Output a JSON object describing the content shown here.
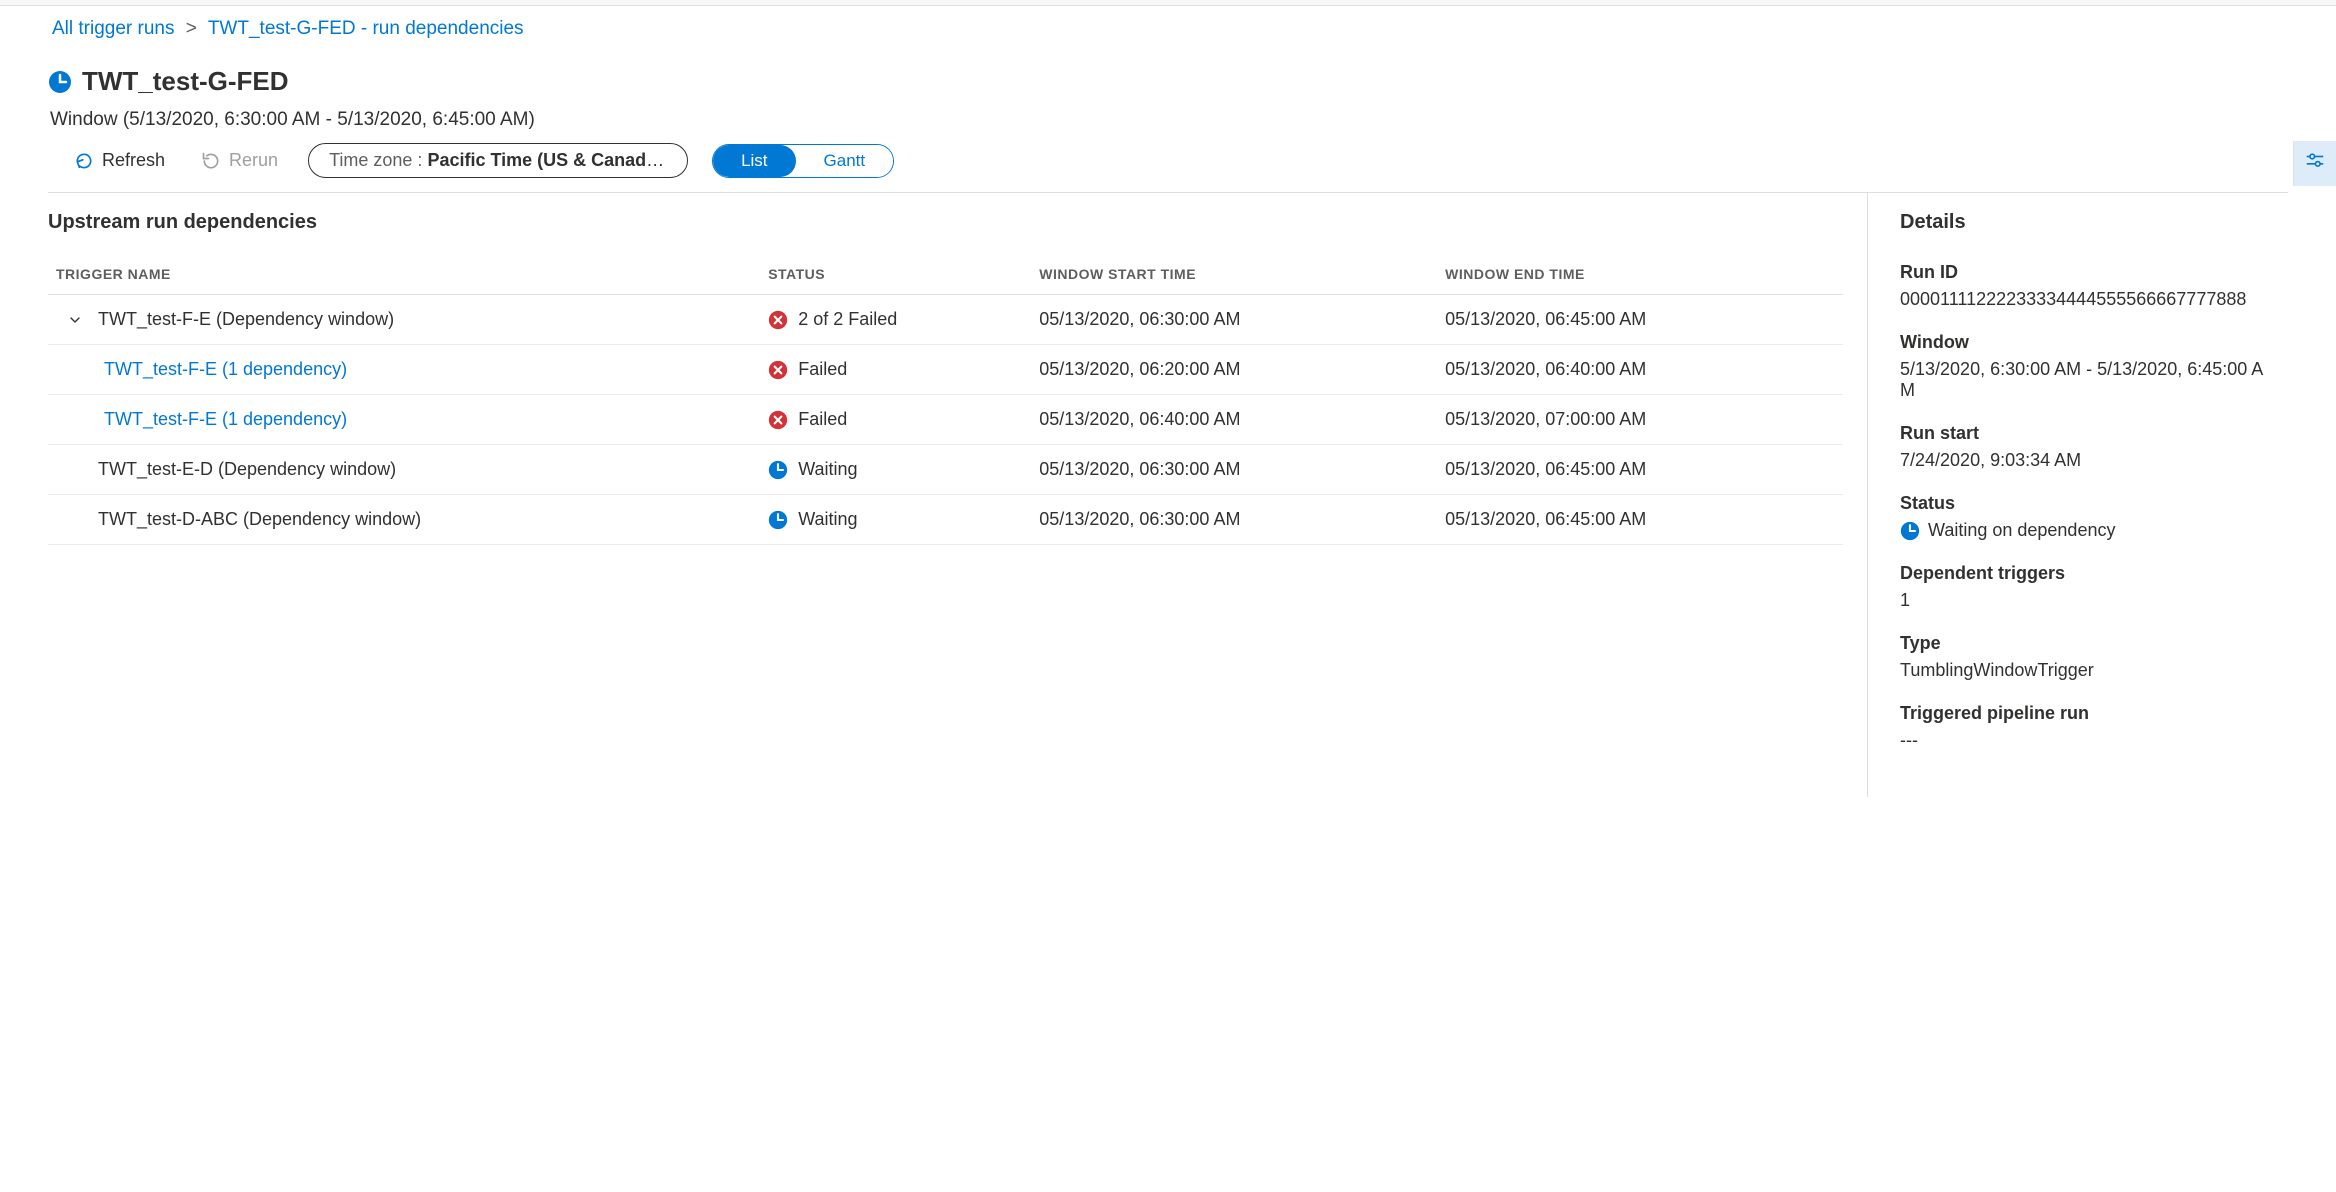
{
  "breadcrumb": {
    "root": "All trigger runs",
    "separator": ">",
    "current": "TWT_test-G-FED - run dependencies"
  },
  "header": {
    "title": "TWT_test-G-FED",
    "window_label": "Window (5/13/2020, 6:30:00 AM - 5/13/2020, 6:45:00 AM)"
  },
  "toolbar": {
    "refresh_label": "Refresh",
    "rerun_label": "Rerun",
    "timezone_prefix": "Time zone : ",
    "timezone_value": "Pacific Time (US & Canada) (UT...",
    "list_label": "List",
    "gantt_label": "Gantt"
  },
  "upstream": {
    "title": "Upstream run dependencies",
    "columns": {
      "trigger_name": "TRIGGER NAME",
      "status": "STATUS",
      "window_start": "WINDOW START TIME",
      "window_end": "WINDOW END TIME"
    },
    "rows": [
      {
        "indent": 0,
        "expandable": true,
        "name": "TWT_test-F-E (Dependency window)",
        "is_link": false,
        "status_kind": "failed",
        "status": "2 of 2 Failed",
        "start": "05/13/2020, 06:30:00 AM",
        "end": "05/13/2020, 06:45:00 AM"
      },
      {
        "indent": 1,
        "expandable": false,
        "name": "TWT_test-F-E (1 dependency)",
        "is_link": true,
        "status_kind": "failed",
        "status": "Failed",
        "start": "05/13/2020, 06:20:00 AM",
        "end": "05/13/2020, 06:40:00 AM"
      },
      {
        "indent": 1,
        "expandable": false,
        "name": "TWT_test-F-E (1 dependency)",
        "is_link": true,
        "status_kind": "failed",
        "status": "Failed",
        "start": "05/13/2020, 06:40:00 AM",
        "end": "05/13/2020, 07:00:00 AM"
      },
      {
        "indent": 0,
        "expandable": false,
        "name": "TWT_test-E-D (Dependency window)",
        "is_link": false,
        "status_kind": "waiting",
        "status": "Waiting",
        "start": "05/13/2020, 06:30:00 AM",
        "end": "05/13/2020, 06:45:00 AM"
      },
      {
        "indent": 0,
        "expandable": false,
        "name": "TWT_test-D-ABC (Dependency window)",
        "is_link": false,
        "status_kind": "waiting",
        "status": "Waiting",
        "start": "05/13/2020, 06:30:00 AM",
        "end": "05/13/2020, 06:45:00 AM"
      }
    ]
  },
  "details": {
    "title": "Details",
    "labels": {
      "run_id": "Run ID",
      "window": "Window",
      "run_start": "Run start",
      "status": "Status",
      "dependent_triggers": "Dependent triggers",
      "type": "Type",
      "triggered_pipeline_run": "Triggered pipeline run"
    },
    "values": {
      "run_id": "00001111222233334444555566667777888",
      "window": "5/13/2020, 6:30:00 AM - 5/13/2020, 6:45:00 AM",
      "run_start": "7/24/2020, 9:03:34 AM",
      "status": "Waiting on dependency",
      "dependent_triggers": "1",
      "type": "TumblingWindowTrigger",
      "triggered_pipeline_run": "---"
    }
  }
}
